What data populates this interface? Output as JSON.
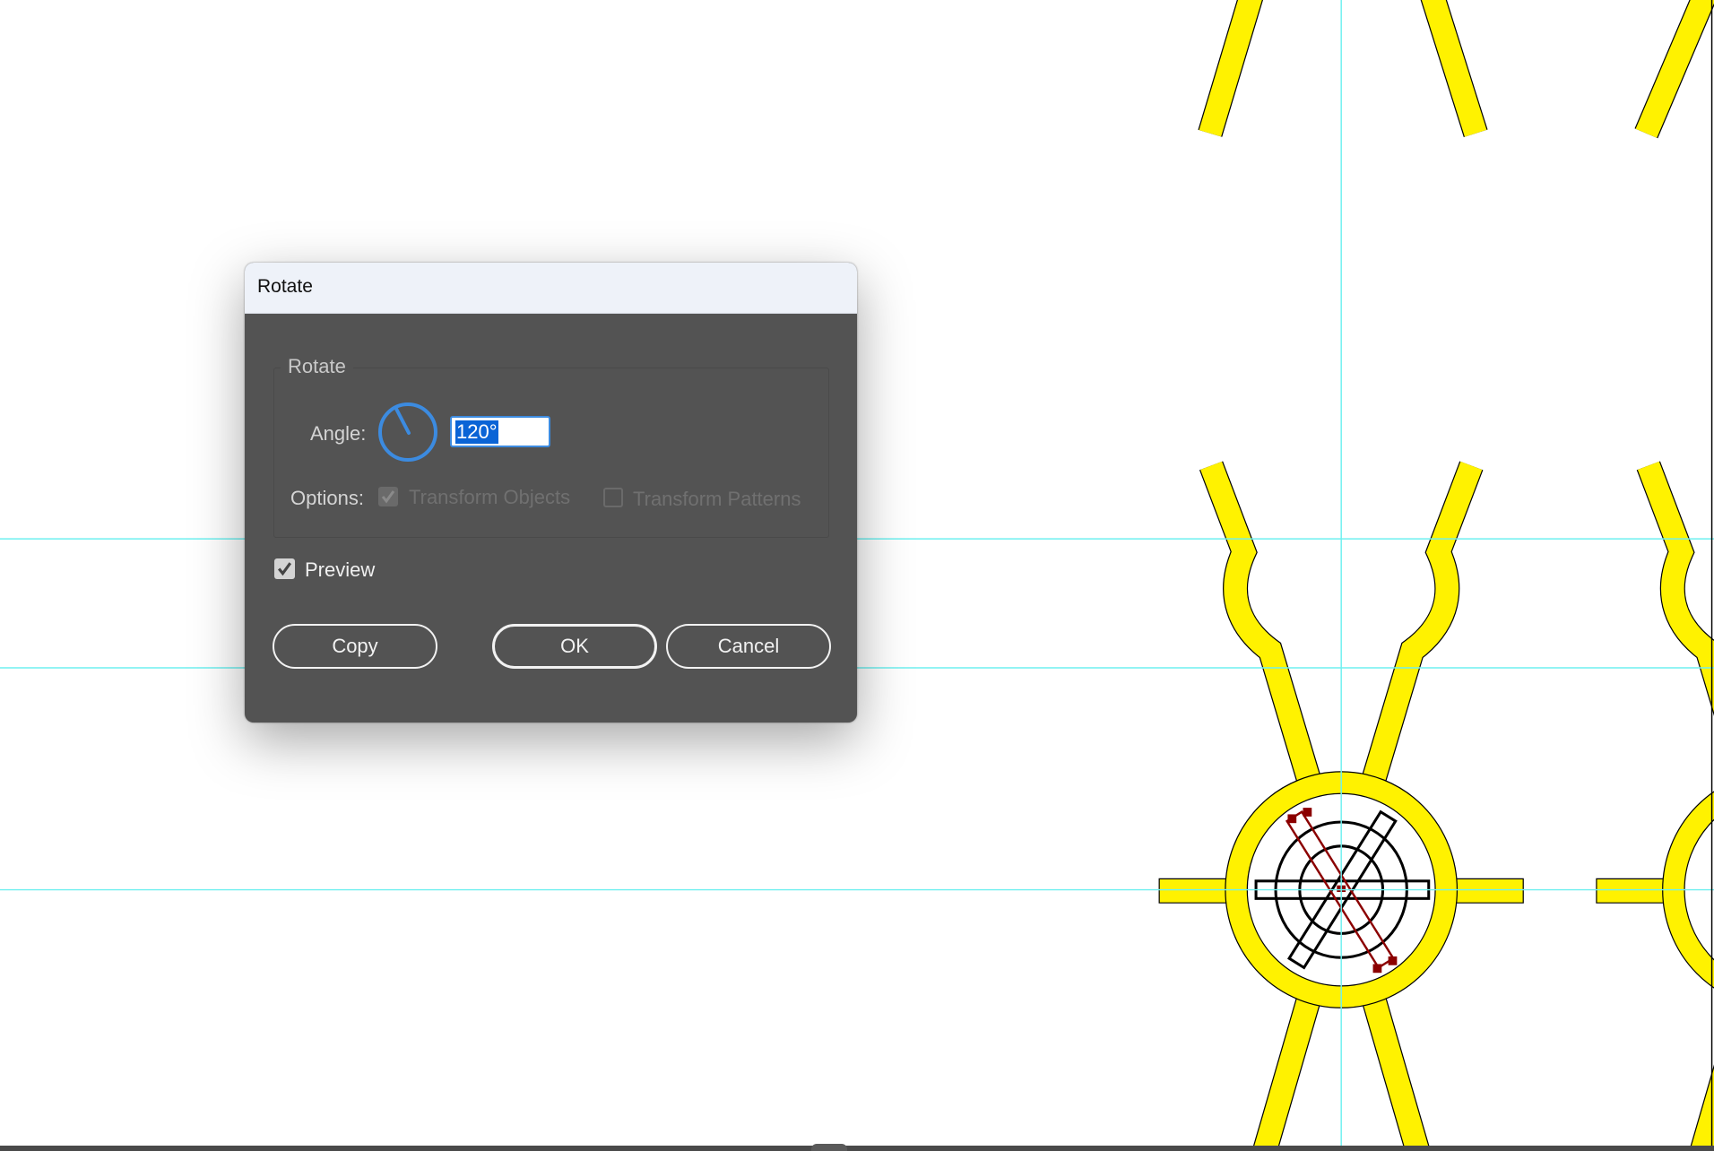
{
  "dialog": {
    "title": "Rotate",
    "group_label": "Rotate",
    "angle_label": "Angle:",
    "angle_value": "120°",
    "angle_degrees": 120,
    "options_label": "Options:",
    "options": [
      {
        "label": "Transform Objects",
        "checked": true,
        "enabled": false
      },
      {
        "label": "Transform Patterns",
        "checked": false,
        "enabled": false
      }
    ],
    "preview_label": "Preview",
    "preview_checked": true,
    "buttons": {
      "copy": "Copy",
      "ok": "OK",
      "cancel": "Cancel"
    }
  },
  "colors": {
    "artwork_fill": "#fff200",
    "guide": "#6ff0f0",
    "dialog_bg": "#535353",
    "accent": "#3c8be0",
    "selection": "#8b0000"
  }
}
